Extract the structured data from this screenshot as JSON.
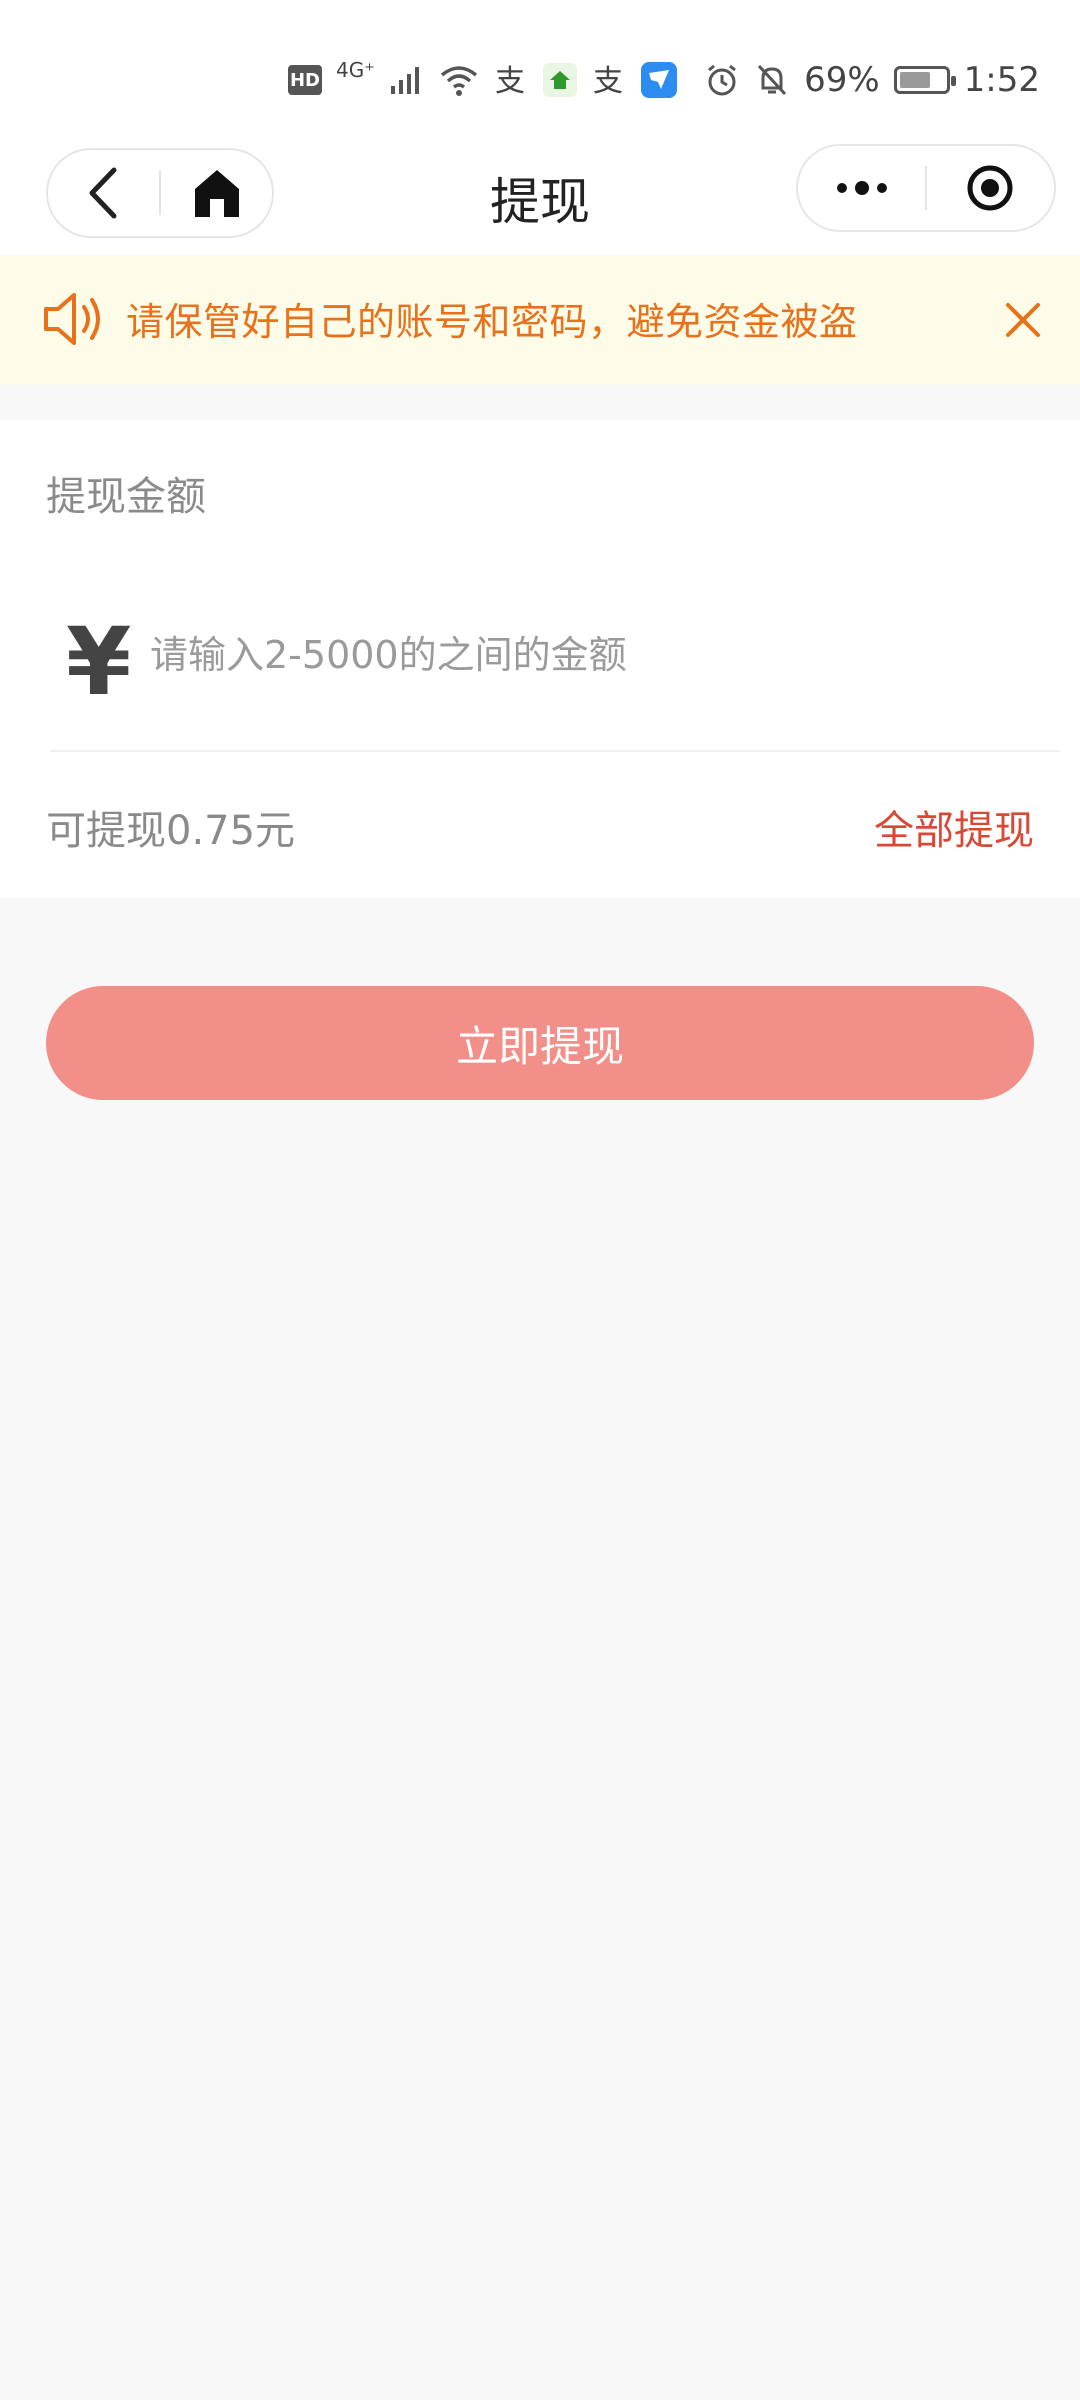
{
  "status_bar": {
    "hd_badge": "HD",
    "network": "4G⁺",
    "battery_percent": "69%",
    "battery_level": 0.69,
    "time": "1:52",
    "app_icons": [
      "alipay-icon",
      "anjuke-icon",
      "alipay-icon",
      "dingtalk-icon"
    ]
  },
  "nav": {
    "title": "提现",
    "more_icon": "more-dots-icon",
    "target_icon": "target-icon"
  },
  "notice": {
    "text": "请保管好自己的账号和密码，避免资金被盗",
    "color": "#e8711c",
    "background": "#fdfce9"
  },
  "withdraw": {
    "amount_label": "提现金额",
    "currency_symbol": "¥",
    "input_placeholder": "请输入2-5000的之间的金额",
    "input_value": "",
    "available_text": "可提现0.75元",
    "withdraw_all_label": "全部提现",
    "withdraw_all_color": "#d94735"
  },
  "submit": {
    "label": "立即提现",
    "color": "#f28f88"
  }
}
